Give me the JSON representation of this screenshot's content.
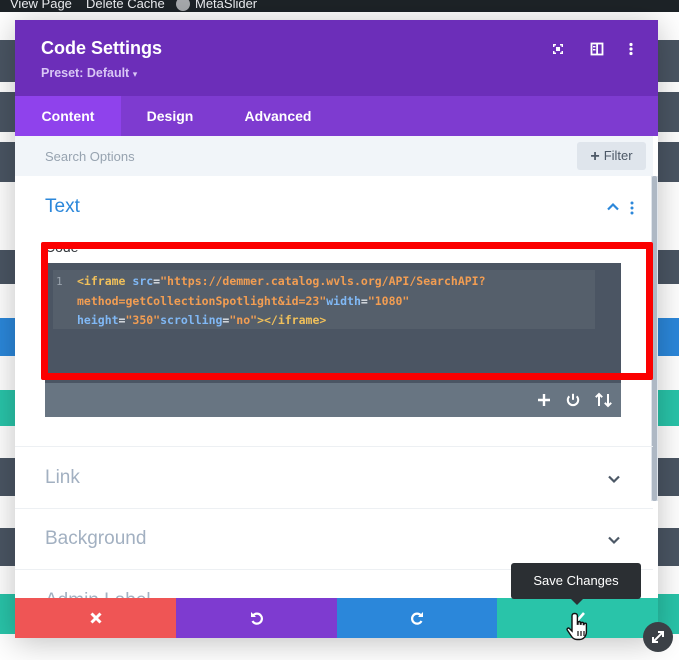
{
  "admin_bar": {
    "view_page": "View Page",
    "delete_cache": "Delete Cache",
    "metaslider": "MetaSlider"
  },
  "modal": {
    "title": "Code Settings",
    "preset": "Preset: Default",
    "tabs": [
      {
        "label": "Content",
        "active": true
      },
      {
        "label": "Design",
        "active": false
      },
      {
        "label": "Advanced",
        "active": false
      }
    ],
    "search": {
      "placeholder": "Search Options",
      "filter_label": "Filter"
    },
    "sections": {
      "text": {
        "title": "Text",
        "expanded": true
      },
      "link": {
        "title": "Link",
        "expanded": false
      },
      "background": {
        "title": "Background",
        "expanded": false
      },
      "admin_label": {
        "title": "Admin Label",
        "expanded": false
      }
    },
    "code_field": {
      "label": "Code",
      "line_number": "1",
      "value": "<iframe src=\"https://demmer.catalog.wvls.org/API/SearchAPI?method=getCollectionSpotlight&id=23\"width=\"1080\" height=\"350\"scrolling=\"no\"></iframe>",
      "lines": [
        {
          "tag": "<iframe ",
          "attr1": "src",
          "eq1": "=",
          "val1": "\"https://demmer.catalog.wvls.org/API/SearchAPI?"
        },
        {
          "val": "method=getCollectionSpotlight&id=23\"",
          "attr": "width",
          "eq": "=",
          "val2": "\"1080\""
        },
        {
          "attr1": "height",
          "eq1": "=",
          "val1": "\"350\"",
          "attr2": "scrolling",
          "eq2": "=",
          "val2": "\"no\"",
          "close": "></iframe>"
        }
      ]
    }
  },
  "tooltip": "Save Changes",
  "colors": {
    "header": "#6c2eb9",
    "tabs": "#7e3bd0",
    "active_tab": "#8f42ec",
    "discard": "#ef5555",
    "undo": "#7e3bd0",
    "redo": "#2b87da",
    "save": "#29c4a9",
    "highlight": "#fb0000",
    "section_title": "#2b87da",
    "collapsed_title": "#a2b0c1"
  },
  "icons": {
    "expand_modal": "fullscreen-icon",
    "sidebar": "sidebar-icon",
    "more": "kebab-icon",
    "discard": "close-icon",
    "undo": "undo-icon",
    "redo": "redo-icon",
    "save": "check-icon"
  }
}
